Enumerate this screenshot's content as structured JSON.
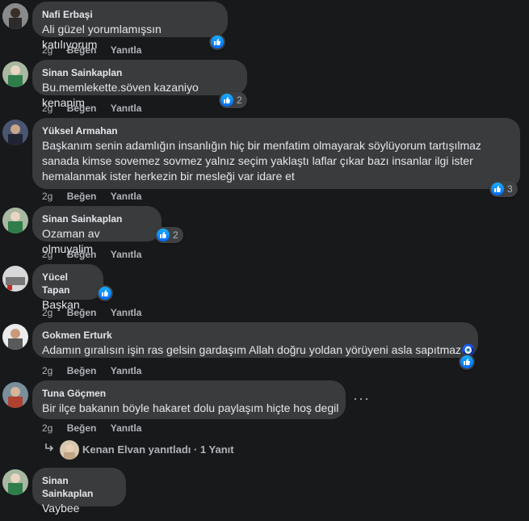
{
  "actions": {
    "time": "2g",
    "like": "Beğen",
    "reply": "Yanıtla"
  },
  "comments": [
    {
      "author": "Nafi Erbaşi",
      "text": "Ali güzel yorumlamışsın katılıyorum",
      "reaction_count": ""
    },
    {
      "author": "Sinan Sainkaplan",
      "text": "Bu.memlekette.söven kazaniyo kenanim",
      "reaction_count": "2"
    },
    {
      "author": "Yüksel Armahan",
      "text": "Başkanım senin adamlığın insanlığın hiç bir menfatim olmayarak söylüyorum tartışılmaz sanada kimse sovemez sovmez yalnız seçim yaklaştı laflar çıkar bazı insanlar ilgi ister hemalanmak ister herkezin bir mesleği var idare et",
      "reaction_count": "3"
    },
    {
      "author": "Sinan Sainkaplan",
      "text": "Ozaman av olmuyalim",
      "reaction_count": "2"
    },
    {
      "author": "Yücel Tapan",
      "text": "Başkan",
      "reaction_count": ""
    },
    {
      "author": "Gokmen Erturk",
      "text": "Adamın gıralısın işin ras gelsin gardaşım Allah doğru yoldan yörüyeni asla sapıtmaz🧿",
      "reaction_count": ""
    },
    {
      "author": "Tuna Göçmen",
      "text": "Bir ilçe bakanın böyle hakaret dolu paylaşım hiçte hoş degil",
      "reaction_count": ""
    },
    {
      "author": "Sinan Sainkaplan",
      "text": "Vaybee",
      "reaction_count": ""
    }
  ],
  "reply_summary": {
    "text": "Kenan Elvan yanıtladı · 1 Yanıt"
  },
  "more_options": "···",
  "colors": {
    "bubble": "#3a3b3c",
    "background": "#18191a",
    "like_blue": "#1877f2"
  },
  "icons": [
    "like-icon",
    "reply-arrow-icon",
    "more-options-icon",
    "avatar"
  ]
}
